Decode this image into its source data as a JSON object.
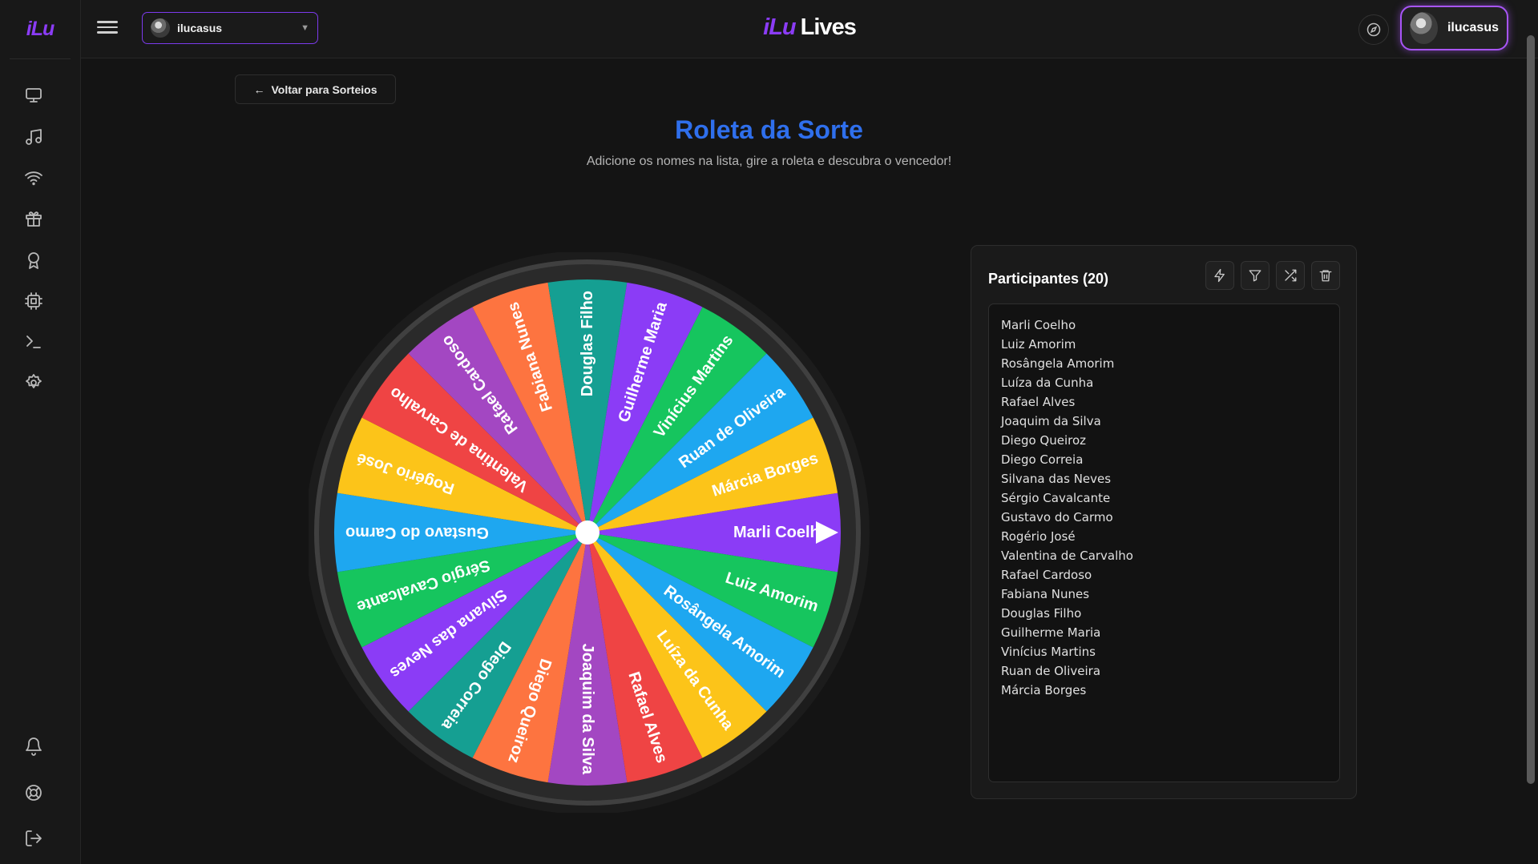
{
  "app": {
    "logo": "iLu",
    "brand_prefix": "iLu",
    "brand_suffix": "Lives",
    "channel": "ilucasus",
    "username": "ilucasus"
  },
  "sidebar": {
    "top_icons": [
      "monitor-icon",
      "music-icon",
      "wifi-icon",
      "gift-icon",
      "award-icon",
      "cpu-icon",
      "terminal-icon",
      "settings-icon"
    ],
    "bottom_icons": [
      "bell-icon",
      "help-icon",
      "logout-icon"
    ]
  },
  "page": {
    "back_label": "Voltar para Sorteios",
    "title": "Roleta da Sorte",
    "subtitle": "Adicione os nomes na lista, gire a roleta e descubra o vencedor!"
  },
  "participants": {
    "title": "Participantes (20)",
    "tools": [
      "zap-icon",
      "filter-icon",
      "shuffle-icon",
      "trash-icon"
    ],
    "names": [
      "Marli Coelho",
      "Luiz Amorim",
      "Rosângela Amorim",
      "Luíza da Cunha",
      "Rafael Alves",
      "Joaquim da Silva",
      "Diego Queiroz",
      "Diego Correia",
      "Silvana das Neves",
      "Sérgio Cavalcante",
      "Gustavo do Carmo",
      "Rogério José",
      "Valentina de Carvalho",
      "Rafael Cardoso",
      "Fabiana Nunes",
      "Douglas Filho",
      "Guilherme Maria",
      "Vinícius Martins",
      "Ruan de Oliveira",
      "Márcia Borges"
    ]
  },
  "wheel": {
    "segments": [
      {
        "name": "Marli Coelho",
        "color": "#8b3cf6"
      },
      {
        "name": "Luiz Amorim",
        "color": "#16c55e"
      },
      {
        "name": "Rosângela Amorim",
        "color": "#1ea7f0"
      },
      {
        "name": "Luíza da Cunha",
        "color": "#fcc419"
      },
      {
        "name": "Rafael Alves",
        "color": "#ef4444"
      },
      {
        "name": "Joaquim da Silva",
        "color": "#a347c2"
      },
      {
        "name": "Diego Queiroz",
        "color": "#fd7440"
      },
      {
        "name": "Diego Correia",
        "color": "#159f92"
      },
      {
        "name": "Silvana das Neves",
        "color": "#8b3cf6"
      },
      {
        "name": "Sérgio Cavalcante",
        "color": "#16c55e"
      },
      {
        "name": "Gustavo do Carmo",
        "color": "#1ea7f0"
      },
      {
        "name": "Rogério José",
        "color": "#fcc419"
      },
      {
        "name": "Valentina de Carvalho",
        "color": "#ef4444"
      },
      {
        "name": "Rafael Cardoso",
        "color": "#a347c2"
      },
      {
        "name": "Fabiana Nunes",
        "color": "#fd7440"
      },
      {
        "name": "Douglas Filho",
        "color": "#159f92"
      },
      {
        "name": "Guilherme Maria",
        "color": "#8b3cf6"
      },
      {
        "name": "Vinícius Martins",
        "color": "#16c55e"
      },
      {
        "name": "Ruan de Oliveira",
        "color": "#1ea7f0"
      },
      {
        "name": "Márcia Borges",
        "color": "#fcc419"
      }
    ]
  }
}
